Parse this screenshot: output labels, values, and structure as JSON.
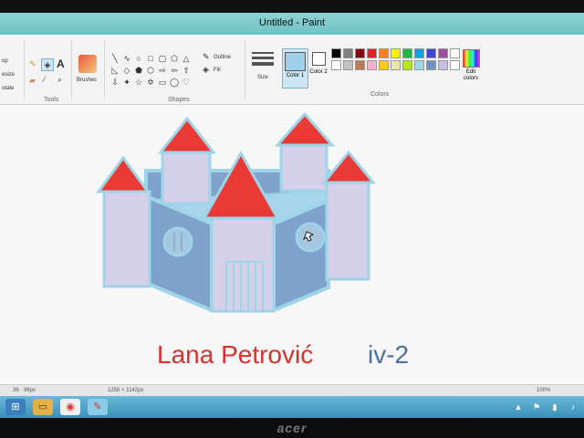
{
  "window": {
    "title": "Untitled - Paint"
  },
  "ribbon": {
    "clipboard_items": [
      "op",
      "esize",
      "otate"
    ],
    "groups": {
      "tools": "Tools",
      "shapes": "Shapes",
      "colors": "Colors"
    },
    "brushes_label": "Brushes",
    "outline_label": "Outline",
    "fill_label": "Fill",
    "size_label": "Size",
    "color1_label": "Color 1",
    "color2_label": "Color 2",
    "edit_colors_label": "Edit colors",
    "text_tool_glyph": "A"
  },
  "palette": [
    "#000000",
    "#7f7f7f",
    "#880015",
    "#ed1c24",
    "#ff7f27",
    "#fff200",
    "#22b14c",
    "#00a2e8",
    "#3f48cc",
    "#a349a4",
    "#ffffff",
    "#ffffff",
    "#c3c3c3",
    "#b97a57",
    "#ffaec9",
    "#ffc90e",
    "#efe4b0",
    "#b5e61d",
    "#99d9ea",
    "#7092be",
    "#c8bfe7",
    "#ffffff"
  ],
  "active_colors": {
    "color1": "#9fd0ea",
    "color2": "#ffffff"
  },
  "drawing": {
    "name_text": "Lana Petrović",
    "class_text": "iv-2",
    "wall_color": "#7fa2cc",
    "tower_color": "#d4d0ea",
    "roof_color": "#ea3a35",
    "outline_color": "#9ed4e8"
  },
  "statusbar": {
    "left": "36 · 96px",
    "mid": "1258 × 1142px",
    "zoom": "100%"
  },
  "taskbar": {
    "icons": [
      "windows-icon",
      "explorer-icon",
      "chrome-icon",
      "paint-icon"
    ]
  },
  "bezel": {
    "brand": "acer"
  }
}
